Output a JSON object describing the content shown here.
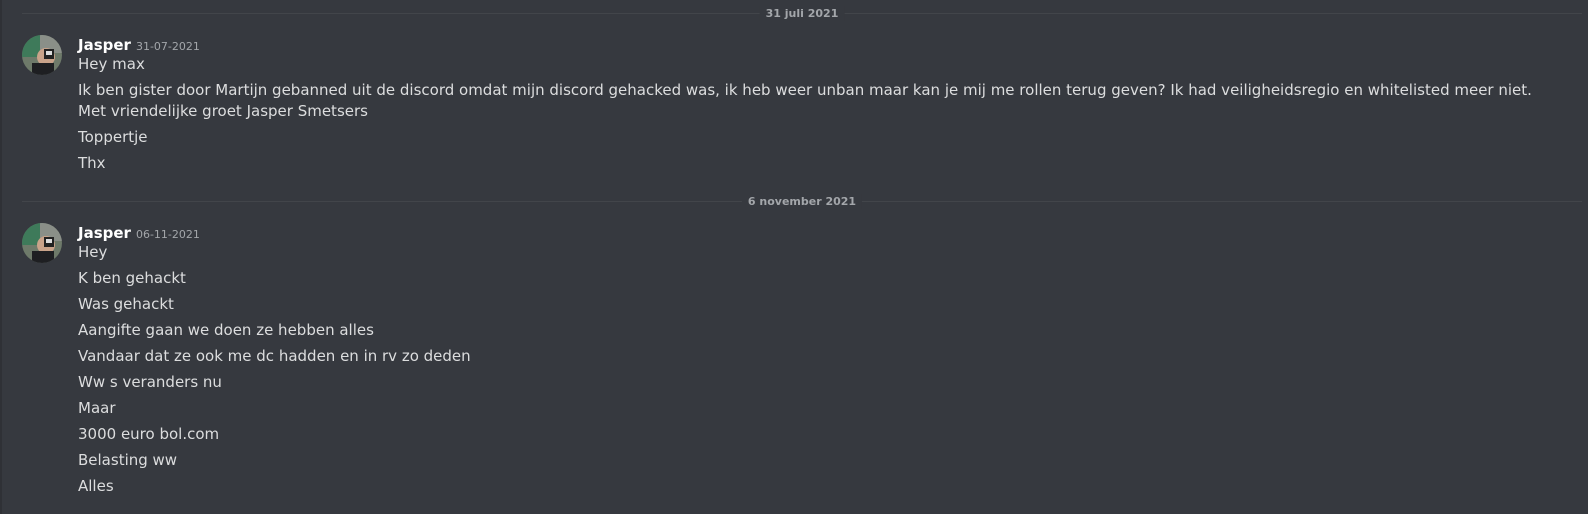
{
  "dividers": [
    "31 juli 2021",
    "6 november 2021"
  ],
  "groups": [
    {
      "username": "Jasper",
      "timestamp": "31-07-2021",
      "messages": [
        "Hey max",
        "Ik ben gister door Martijn gebanned uit de discord omdat mijn discord gehacked was, ik heb weer unban maar kan je mij me rollen terug geven? Ik had veiligheidsregio en whitelisted meer niet. Met vriendelijke groet Jasper Smetsers",
        "Toppertje",
        "Thx"
      ]
    },
    {
      "username": "Jasper",
      "timestamp": "06-11-2021",
      "messages": [
        "Hey",
        "K ben gehackt",
        "Was gehackt",
        "Aangifte gaan we doen ze hebben alles",
        "Vandaar dat ze ook me dc hadden en in rv zo deden",
        "Ww s veranders nu",
        "Maar",
        "3000 euro bol.com",
        "Belasting ww",
        "Alles"
      ]
    }
  ],
  "colors": {
    "background": "#36393f",
    "text": "#dcddde",
    "username": "#ffffff",
    "muted": "#a3a6aa",
    "divider": "#42454a"
  }
}
